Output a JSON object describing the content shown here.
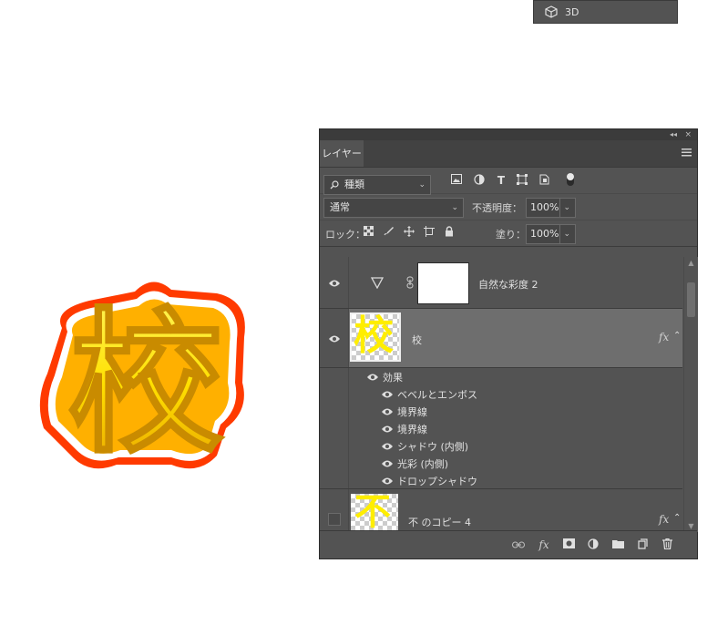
{
  "mini_panel": {
    "icon": "cube-icon",
    "label": "3D"
  },
  "artwork": {
    "glyph": "校"
  },
  "panel": {
    "title_buttons": {
      "collapse": "◂◂",
      "close": "×"
    },
    "tab_label": "レイヤー",
    "filter": {
      "kind_label": "種類",
      "icons": [
        "image-filter-icon",
        "adjustment-filter-icon",
        "type-filter-icon",
        "shape-filter-icon",
        "smartobject-filter-icon"
      ]
    },
    "blend_mode": "通常",
    "opacity_label": "不透明度：",
    "opacity_value": "100%",
    "lock_label": "ロック：",
    "fill_label": "塗り：",
    "fill_value": "100%",
    "layers": [
      {
        "name": "自然な彩度 2",
        "visible": true,
        "type": "adjustment"
      },
      {
        "name": "校",
        "visible": true,
        "selected": true,
        "fx": "fx",
        "thumb_glyph": "校"
      },
      {
        "name": "不 のコピー 4",
        "visible": false,
        "fx": "fx",
        "thumb_glyph": "不"
      }
    ],
    "effects_header": "効果",
    "effects": [
      "ベベルとエンボス",
      "境界線",
      "境界線",
      "シャドウ (内側)",
      "光彩 (内側)",
      "ドロップシャドウ"
    ],
    "colors": {
      "panel_bg": "#535353",
      "selected_row": "#6e6e6e",
      "glyph_yellow": "#ffee00",
      "stroke_red": "#ff4400"
    }
  }
}
